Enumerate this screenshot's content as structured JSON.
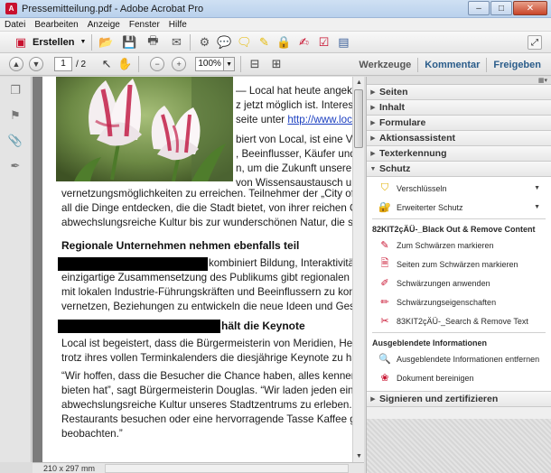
{
  "window": {
    "title": "Pressemitteilung.pdf - Adobe Acrobat Pro",
    "minimize": "–",
    "maximize": "□",
    "close": "✕"
  },
  "menu": [
    "Datei",
    "Bearbeiten",
    "Anzeige",
    "Fenster",
    "Hilfe"
  ],
  "toolbar": {
    "create_label": "Erstellen"
  },
  "nav": {
    "page_current": "1",
    "page_total": "/ 2",
    "zoom": "100%",
    "tools": "Werkzeuge",
    "comment": "Kommentar",
    "share": "Freigeben"
  },
  "document": {
    "intro_lines": [
      "— Local hat heute angekün",
      "z jetzt möglich ist. Interesse",
      "seite unter ",
      "biert von Local, ist eine Vera",
      ", Beeinflusser, Käufer und E",
      "n, um die Zukunft unserer S",
      "von Wissensaustausch und",
      "vernetzungsmöglichkeiten zu erreichen. Teilnehmer der „City of M",
      "all die Dinge entdecken, die die Stadt bietet, von ihrer reichen Gesc",
      "abwechslungsreiche Kultur bis zur wunderschönen Natur, die sie u"
    ],
    "link_text": "http://www.local",
    "heading1": "Regionale Unternehmen nehmen ebenfalls teil",
    "para2": [
      "kombiniert Bildung, Interaktivität,",
      "einzigartige Zusammensetzung des Publikums gibt regionalen Unt",
      "mit lokalen Industrie-Führungskräften und Beeinflussern zu komm",
      "vernetzen, Beziehungen zu entwickeln die neue Ideen und Geschä"
    ],
    "heading2": "hält die Keynote",
    "para3": [
      "Local ist begeistert, dass die Bürgermeisterin von Meridien, Heathe",
      "trotz ihres vollen Terminkalenders die diesjährige Keynote zu halte"
    ],
    "para4": [
      "“Wir hoffen, dass die Besucher die Chance haben, alles kennen zu l",
      "bieten hat”, sagt Bürgermeisterin Douglas. “Wir laden jeden ein, d",
      "abwechslungsreiche Kultur unseres Stadtzentrums zu erleben. Dor",
      "Restaurants besuchen oder eine hervorragende Tasse Kaffee genie",
      "beobachten.”"
    ]
  },
  "status": {
    "page_size": "210 x 297 mm"
  },
  "panel": {
    "sections": [
      "Seiten",
      "Inhalt",
      "Formulare",
      "Aktionsassistent",
      "Texterkennung"
    ],
    "protection": {
      "title": "Schutz",
      "items": [
        "Verschlüsseln",
        "Erweiterter Schutz"
      ],
      "group1_title": "82KIT2çÄÜ-_Black Out & Remove Content",
      "group1_items": [
        "Zum Schwärzen markieren",
        "Seiten zum Schwärzen markieren",
        "Schwärzungen anwenden",
        "Schwärzungseigenschaften",
        "83KIT2çÄÜ-_Search & Remove Text"
      ],
      "group2_title": "Ausgeblendete Informationen",
      "group2_items": [
        "Ausgeblendete Informationen entfernen",
        "Dokument bereinigen"
      ]
    },
    "sign_section": "Signieren und zertifizieren"
  }
}
